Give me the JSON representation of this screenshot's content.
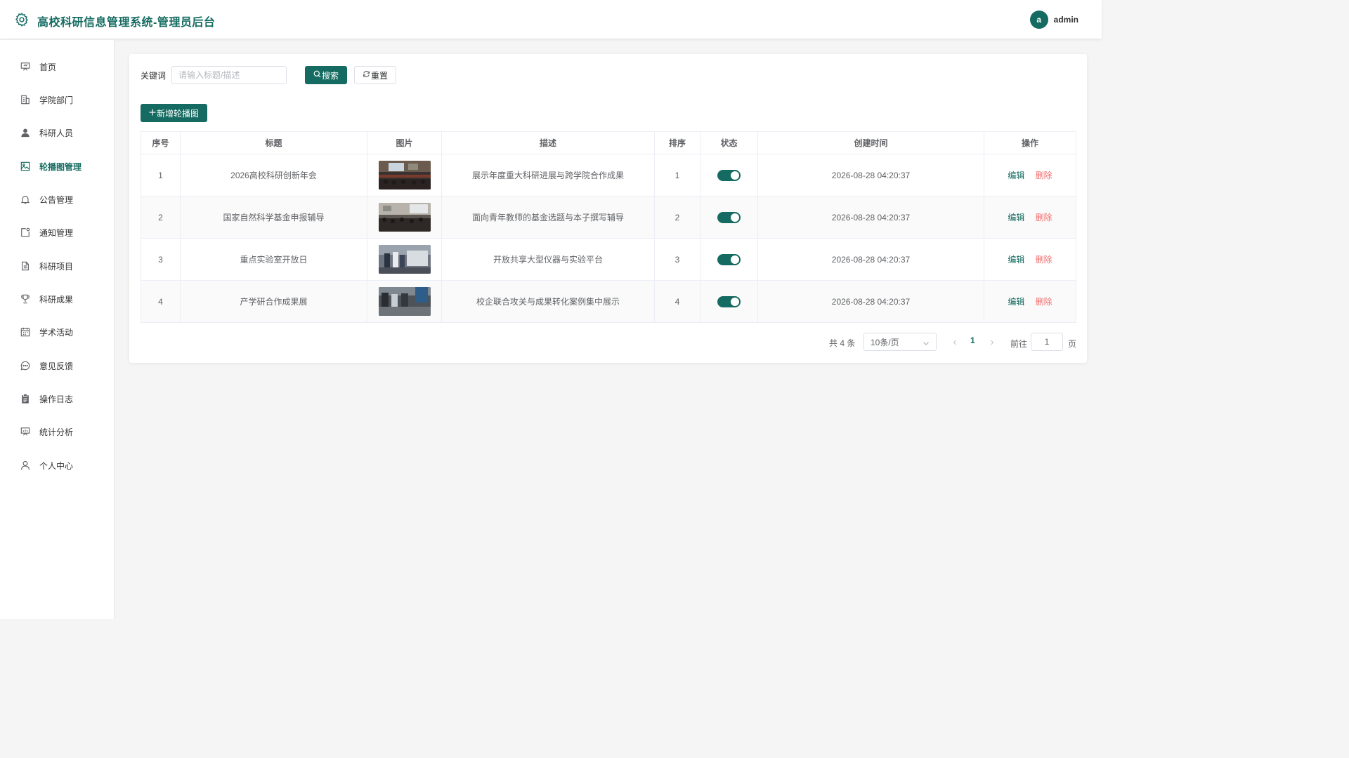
{
  "app": {
    "title": "高校科研信息管理系统-管理员后台",
    "accent": "#156b61"
  },
  "user": {
    "avatar_letter": "a",
    "name": "admin"
  },
  "sidebar": {
    "items": [
      {
        "label": "首页",
        "icon": "presentation-icon"
      },
      {
        "label": "学院部门",
        "icon": "building-icon"
      },
      {
        "label": "科研人员",
        "icon": "user-icon"
      },
      {
        "label": "轮播图管理",
        "icon": "picture-icon",
        "active": true
      },
      {
        "label": "公告管理",
        "icon": "bell-icon"
      },
      {
        "label": "通知管理",
        "icon": "notification-icon"
      },
      {
        "label": "科研项目",
        "icon": "document-icon"
      },
      {
        "label": "科研成果",
        "icon": "trophy-icon"
      },
      {
        "label": "学术活动",
        "icon": "calendar-icon"
      },
      {
        "label": "意见反馈",
        "icon": "chat-icon"
      },
      {
        "label": "操作日志",
        "icon": "clipboard-icon"
      },
      {
        "label": "统计分析",
        "icon": "chart-board-icon"
      },
      {
        "label": "个人中心",
        "icon": "person-icon"
      }
    ]
  },
  "search": {
    "label": "关键词",
    "placeholder": "请输入标题/描述",
    "value": "",
    "search_label": "搜索",
    "reset_label": "重置"
  },
  "toolbar": {
    "add_label": "新增轮播图"
  },
  "table": {
    "columns": [
      "序号",
      "标题",
      "图片",
      "描述",
      "排序",
      "状态",
      "创建时间",
      "操作"
    ],
    "rows": [
      {
        "index": "1",
        "title": "2026高校科研创新年会",
        "description": "展示年度重大科研进展与跨学院合作成果",
        "sort": "1",
        "enabled": true,
        "created": "2026-08-28 04:20:37"
      },
      {
        "index": "2",
        "title": "国家自然科学基金申报辅导",
        "description": "面向青年教师的基金选题与本子撰写辅导",
        "sort": "2",
        "enabled": true,
        "created": "2026-08-28 04:20:37"
      },
      {
        "index": "3",
        "title": "重点实验室开放日",
        "description": "开放共享大型仪器与实验平台",
        "sort": "3",
        "enabled": true,
        "created": "2026-08-28 04:20:37"
      },
      {
        "index": "4",
        "title": "产学研合作成果展",
        "description": "校企联合攻关与成果转化案例集中展示",
        "sort": "4",
        "enabled": true,
        "created": "2026-08-28 04:20:37"
      }
    ],
    "edit_label": "编辑",
    "delete_label": "删除"
  },
  "pagination": {
    "total_text": "共 4 条",
    "page_size": "10条/页",
    "current_page": "1",
    "goto_label": "前往",
    "goto_value": "1",
    "page_suffix": "页"
  }
}
